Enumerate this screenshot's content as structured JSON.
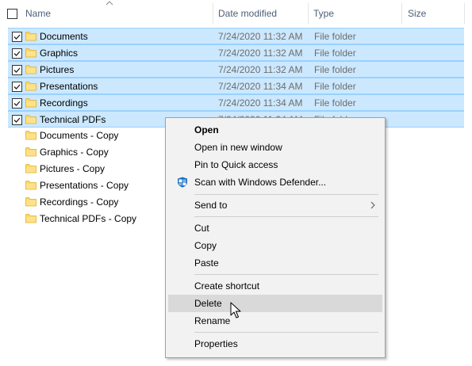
{
  "header": {
    "columns": {
      "name": "Name",
      "date": "Date modified",
      "type": "Type",
      "size": "Size"
    },
    "sort": "ascending"
  },
  "files": [
    {
      "name": "Documents",
      "date": "7/24/2020 11:32 AM",
      "type": "File folder",
      "selected": true
    },
    {
      "name": "Graphics",
      "date": "7/24/2020 11:32 AM",
      "type": "File folder",
      "selected": true
    },
    {
      "name": "Pictures",
      "date": "7/24/2020 11:32 AM",
      "type": "File folder",
      "selected": true
    },
    {
      "name": "Presentations",
      "date": "7/24/2020 11:34 AM",
      "type": "File folder",
      "selected": true
    },
    {
      "name": "Recordings",
      "date": "7/24/2020 11:34 AM",
      "type": "File folder",
      "selected": true
    },
    {
      "name": "Technical PDFs",
      "date": "7/24/2020 11:34 AM",
      "type": "File folder",
      "selected": true
    },
    {
      "name": "Documents - Copy",
      "selected": false
    },
    {
      "name": "Graphics - Copy",
      "selected": false
    },
    {
      "name": "Pictures - Copy",
      "selected": false
    },
    {
      "name": "Presentations - Copy",
      "selected": false
    },
    {
      "name": "Recordings - Copy",
      "selected": false
    },
    {
      "name": "Technical PDFs - Copy",
      "selected": false
    }
  ],
  "context_menu": {
    "open": "Open",
    "open_new_window": "Open in new window",
    "pin_quick_access": "Pin to Quick access",
    "scan_defender": "Scan with Windows Defender...",
    "send_to": "Send to",
    "cut": "Cut",
    "copy": "Copy",
    "paste": "Paste",
    "create_shortcut": "Create shortcut",
    "delete": "Delete",
    "rename": "Rename",
    "properties": "Properties",
    "hovered": "delete"
  },
  "colors": {
    "selection_bg": "#cce8ff",
    "selection_border": "#99d1ff",
    "folder": "#ffd75e",
    "menu_hover": "#d9d9d9",
    "header_text": "#4c607a"
  }
}
